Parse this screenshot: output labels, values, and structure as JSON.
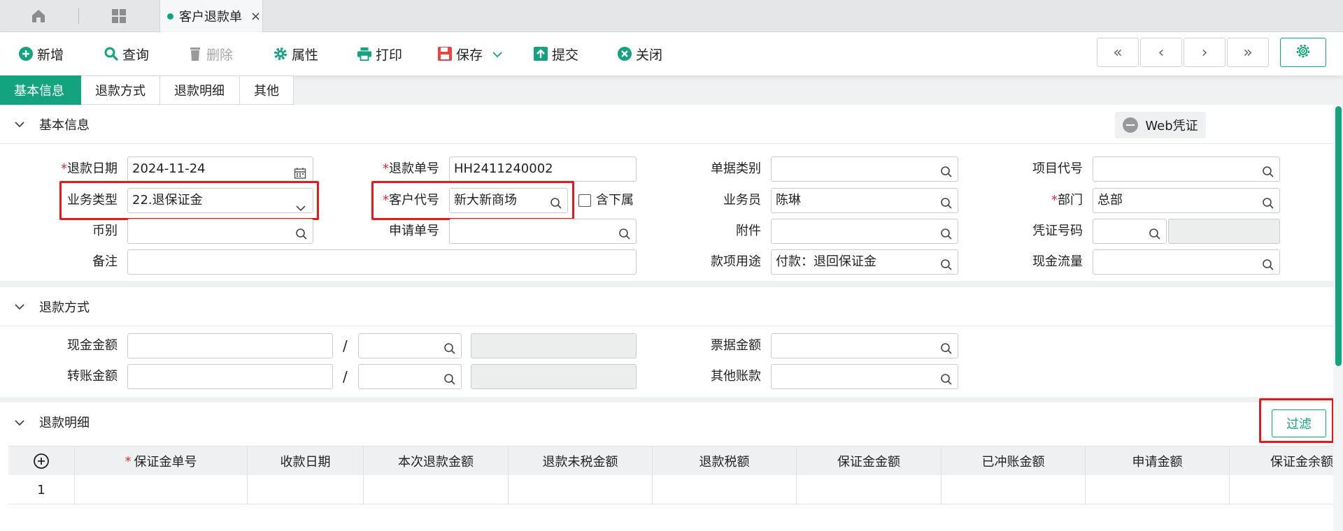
{
  "tabbar": {
    "home_icon": "home-icon",
    "apps_icon": "grid-icon",
    "doc_tab": {
      "label": "客户退款单",
      "close": "×"
    }
  },
  "toolbar": {
    "new": "新增",
    "query": "查询",
    "delete": "删除",
    "properties": "属性",
    "print": "打印",
    "save": "保存",
    "submit": "提交",
    "close": "关闭",
    "nav": [
      "«",
      "‹",
      "›",
      "»"
    ]
  },
  "section_tabs": [
    "基本信息",
    "退款方式",
    "退款明细",
    "其他"
  ],
  "basic": {
    "title": "基本信息",
    "web_voucher": "Web凭证",
    "fields": {
      "refund_date": {
        "label": "退款日期",
        "value": "2024-11-24"
      },
      "refund_no": {
        "label": "退款单号",
        "value": "HH2411240002"
      },
      "doc_type": {
        "label": "单据类别",
        "value": ""
      },
      "project_code": {
        "label": "项目代号",
        "value": ""
      },
      "biz_type": {
        "label": "业务类型",
        "value": "22.退保证金"
      },
      "customer_code": {
        "label": "客户代号",
        "value": "新大新商场"
      },
      "include_sub": {
        "label": "含下属"
      },
      "salesman": {
        "label": "业务员",
        "value": "陈琳"
      },
      "department": {
        "label": "部门",
        "value": "总部"
      },
      "currency": {
        "label": "币别",
        "value": ""
      },
      "apply_no": {
        "label": "申请单号",
        "value": ""
      },
      "attachment": {
        "label": "附件",
        "value": ""
      },
      "voucher_no": {
        "label": "凭证号码",
        "value": ""
      },
      "remark": {
        "label": "备注",
        "value": ""
      },
      "purpose": {
        "label": "款项用途",
        "value": "付款：退回保证金"
      },
      "cash_flow": {
        "label": "现金流量",
        "value": ""
      }
    }
  },
  "method": {
    "title": "退款方式",
    "cash_amount": "现金金额",
    "transfer_amount": "转账金额",
    "bill_amount": "票据金额",
    "other_account": "其他账款",
    "slash": "/"
  },
  "detail": {
    "title": "退款明细",
    "filter": "过滤",
    "add_icon": "plus-circle-icon",
    "columns": [
      "保证金单号",
      "收款日期",
      "本次退款金额",
      "退款未税金额",
      "退款税额",
      "保证金金额",
      "已冲账金额",
      "申请金额",
      "保证金余额"
    ],
    "rows": [
      {
        "no": "1"
      }
    ]
  },
  "colors": {
    "accent": "#14a37f",
    "required": "#e02b2b",
    "highlight": "#e21a1a"
  }
}
